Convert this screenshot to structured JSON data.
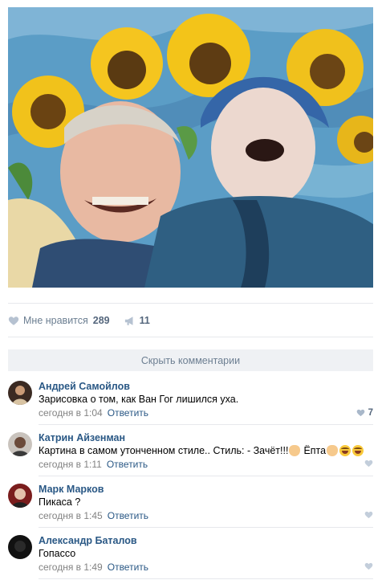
{
  "post": {
    "image_alt": "painting",
    "likes_label": "Мне нравится",
    "likes_count": "289",
    "shares_count": "11"
  },
  "comments_block": {
    "hide_label": "Скрыть комментарии"
  },
  "comments": [
    {
      "author": "Андрей Самойлов",
      "text": "Зарисовка о том, как Ван Гог лишился уха.",
      "time": "сегодня в 1:04",
      "reply": "Ответить",
      "likes": "7"
    },
    {
      "author": "Катрин Айзенман",
      "text": "Картина в самом утонченном стиле.. Стиль: - Зачёт!!!",
      "text_after": "Ёпта",
      "time": "сегодня в 1:11",
      "reply": "Ответить",
      "likes": ""
    },
    {
      "author": "Марк Марков",
      "text": "Пикаса ?",
      "time": "сегодня в 1:45",
      "reply": "Ответить",
      "likes": ""
    },
    {
      "author": "Александр Баталов",
      "text": "Гопассо",
      "time": "сегодня в 1:49",
      "reply": "Ответить",
      "likes": ""
    }
  ],
  "colors": {
    "link": "#2a5885",
    "muted": "#828282",
    "bar_bg": "#eff1f4"
  },
  "icons": {
    "like": "heart-icon",
    "share": "megaphone-icon"
  }
}
